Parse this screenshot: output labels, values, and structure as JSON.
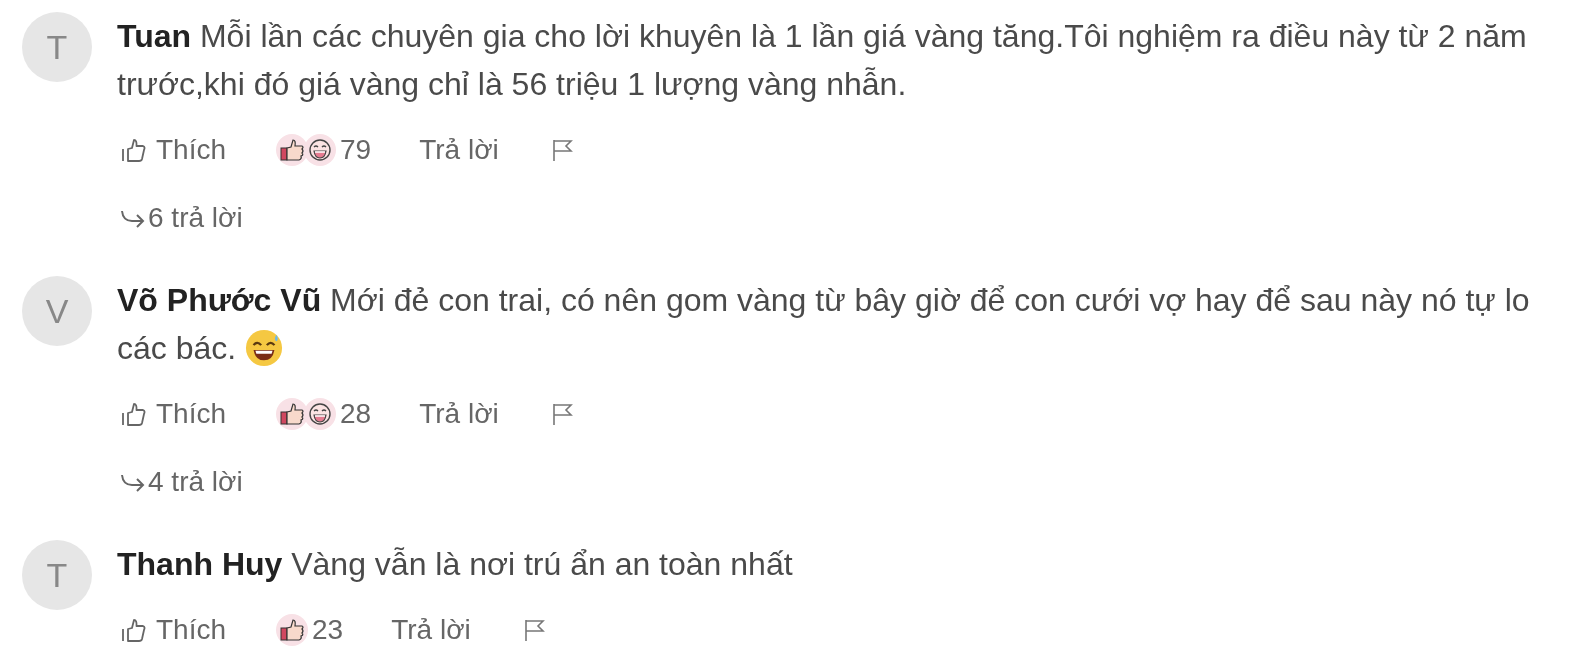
{
  "comments": [
    {
      "avatar": "T",
      "name": "Tuan",
      "text": "Mỗi lần các chuyên gia cho lời khuyên là 1 lần giá vàng tăng.Tôi nghiệm ra điều này từ 2 năm trước,khi đó giá vàng chỉ là 56 triệu 1 lượng vàng nhẫn.",
      "like_label": "Thích",
      "reactions": [
        {
          "kind": "like"
        },
        {
          "kind": "haha"
        }
      ],
      "count": "79",
      "reply_label": "Trả lời",
      "replies": "6 trả lời"
    },
    {
      "avatar": "V",
      "name": "Võ Phước Vũ",
      "text": "Mới đẻ con trai, có nên gom vàng từ bây giờ để con cưới vợ hay để sau này nó tự lo các bác.",
      "emoji": {
        "kind": "grin-sweat"
      },
      "like_label": "Thích",
      "reactions": [
        {
          "kind": "like"
        },
        {
          "kind": "haha"
        }
      ],
      "count": "28",
      "reply_label": "Trả lời",
      "replies": "4 trả lời"
    },
    {
      "avatar": "T",
      "name": "Thanh Huy",
      "text": "Vàng vẫn là nơi trú ẩn an toàn nhất",
      "like_label": "Thích",
      "reactions": [
        {
          "kind": "like"
        }
      ],
      "count": "23",
      "reply_label": "Trả lời"
    }
  ]
}
